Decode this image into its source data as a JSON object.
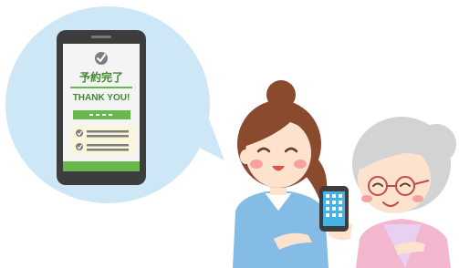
{
  "phone_screen": {
    "title": "予約完了",
    "message": "THANK YOU!"
  },
  "colors": {
    "bubble": "#CDE7F7",
    "phone_body": "#3D3D3D",
    "screen_bg": "#F4F4F4",
    "accent_green": "#66B94A",
    "dark_green": "#3F8A2C",
    "cream": "#FBF5DA",
    "nurse_uniform": "#84BCE6",
    "hair_brown": "#8A4A2E",
    "skin": "#FDE3CE",
    "cheek": "#F7A1A1",
    "elder_hair": "#D3D3D3",
    "elder_shirt": "#F2B7CF",
    "elder_inner": "#E7D0F0",
    "elder_phone_screen": "#46B3E7"
  },
  "icons": {
    "header_icon": "check-circle-icon",
    "list_icon": "check-circle-icon"
  }
}
